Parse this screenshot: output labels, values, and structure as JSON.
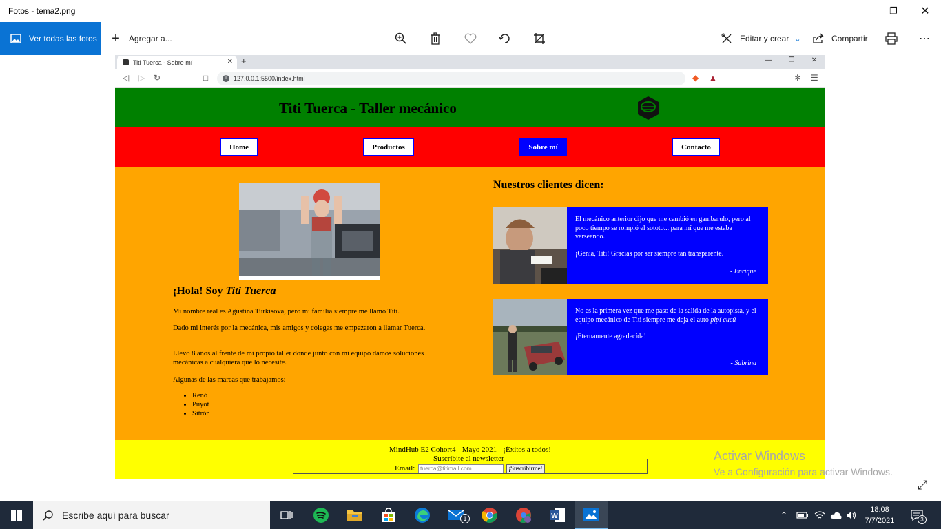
{
  "app": {
    "title": "Fotos - tema2.png",
    "all_photos": "Ver todas las fotos",
    "add_to": "Agregar a...",
    "edit_create": "Editar y crear",
    "share": "Compartir"
  },
  "browser": {
    "tab_title": "Titi Tuerca - Sobre mí",
    "url": "127.0.0.1:5500/index.html"
  },
  "site": {
    "title": "Titi Tuerca - Taller mecánico",
    "nav": [
      {
        "label": "Home"
      },
      {
        "label": "Productos"
      },
      {
        "label": "Sobre mí",
        "active": true
      },
      {
        "label": "Contacto"
      }
    ],
    "about": {
      "heading_prefix": "¡Hola! Soy ",
      "heading_name": "Titi Tuerca",
      "paragraphs": [
        "Mi nombre real es Agustina Turkisova, pero mi familia siempre me llamó Titi.",
        "Dado mi interés por la mecánica, mis amigos y colegas me empezaron a llamar Tuerca.",
        "Llevo 8 años al frente de mi propio taller donde junto con mi equipo damos soluciones mecánicas a cualquiera que lo necesite.",
        "Algunas de las marcas que trabajamos:"
      ],
      "brands": [
        "Renó",
        "Puyot",
        "Sitrón"
      ]
    },
    "clients": {
      "title": "Nuestros clientes dicen:",
      "testimonials": [
        {
          "text1": "El mecánico anterior dijo que me cambió en gambarulo, pero al poco tiempo se rompió el sototo... para mí que me estaba verseando.",
          "text2": "¡Genia, Titi! Gracias por ser siempre tan transparente.",
          "author": "- Enrique"
        },
        {
          "text1a": "No es la primera vez que me paso de la salida de la autopista, y el equipo mecánico de Titi siempre me deja el auto ",
          "text1b": "pipí cucú",
          "text2": "¡Eternamente agradecida!",
          "author": "- Sabrina"
        }
      ]
    },
    "footer": {
      "credits": "MindHub E2 Cohort4 - Mayo 2021 - ¡Éxitos a todos!",
      "legend": "Suscribite al newsletter",
      "email_label": "Email:",
      "email_placeholder": "tuerca@titimail.com",
      "button": "¡Suscribirme!"
    }
  },
  "watermark": {
    "line1": "Activar Windows",
    "line2": "Ve a Configuración para activar Windows."
  },
  "taskbar": {
    "search_placeholder": "Escribe aquí para buscar",
    "time": "18:08",
    "date": "7/7/2021",
    "notifications": "3",
    "mail_badge": "1"
  },
  "colors": {
    "header": "#008000",
    "nav": "#ff0000",
    "main": "#ffa500",
    "footer": "#ffff00",
    "accent": "#0000ff",
    "photos_blue": "#0a73d4"
  }
}
